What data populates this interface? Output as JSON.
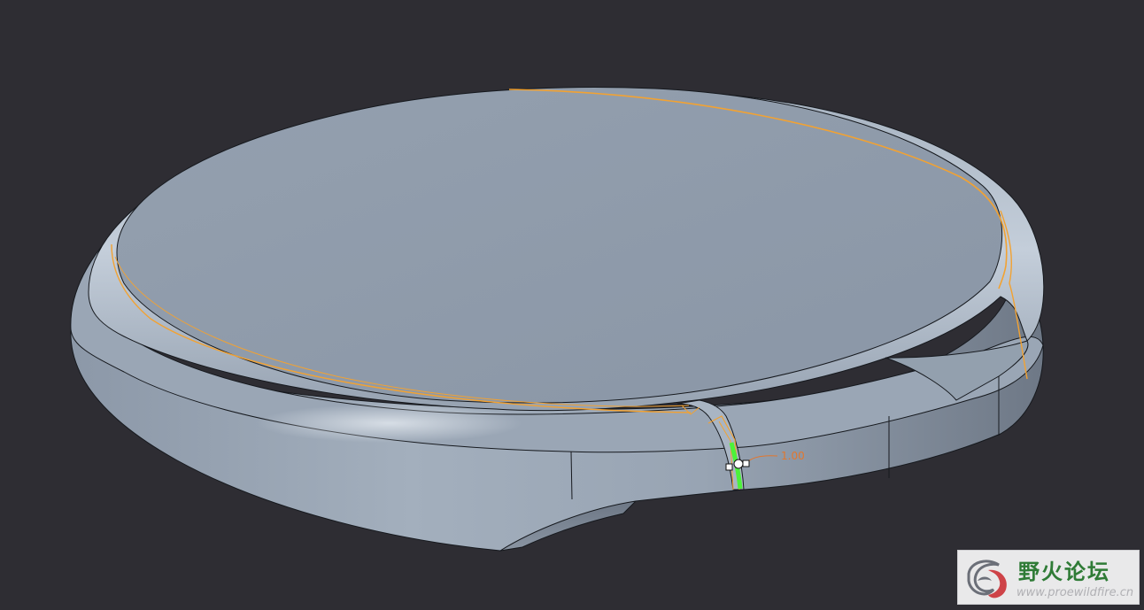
{
  "viewport": {
    "background": "#2e2d33",
    "model_fill": "#8e9aaa",
    "edge_color": "#16191e",
    "highlight_color": "#f2a232",
    "handle_color": "#4cf23a",
    "dimension": {
      "value": "1.00",
      "color": "#e2772e"
    }
  },
  "watermark": {
    "title": "野火论坛",
    "url": "www.proewildfire.cn",
    "title_color": "#2f7b36",
    "url_color": "#b0b0b4",
    "logo_icon": "flame-logo-icon"
  }
}
